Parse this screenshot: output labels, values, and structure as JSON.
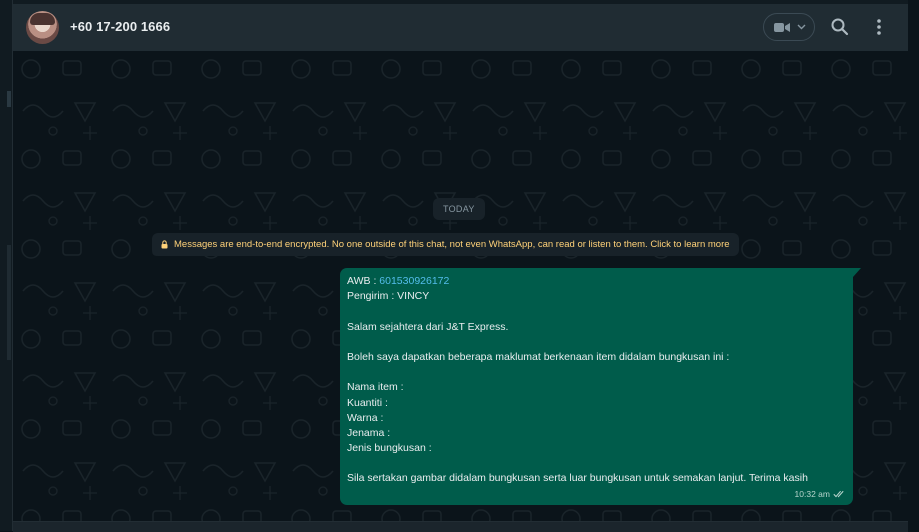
{
  "header": {
    "contact_name": "+60 17-200 1666",
    "video_call_icon": "video-camera-icon",
    "search_icon": "search-icon",
    "menu_icon": "kebab-menu-icon"
  },
  "chat": {
    "date_chip": "TODAY",
    "encryption_notice": "Messages are end-to-end encrypted. No one outside of this chat, not even WhatsApp, can read or listen to them. Click to learn more",
    "message": {
      "awb_label": "AWB : ",
      "awb_number": "601530926172",
      "lines": [
        "Pengirim : VINCY",
        "",
        "Salam sejahtera dari J&T Express.",
        "",
        "Boleh saya dapatkan beberapa maklumat berkenaan item didalam bungkusan ini :",
        "",
        "Nama item :",
        "Kuantiti :",
        "Warna :",
        "Jenama :",
        "Jenis bungkusan :",
        "",
        "Sila sertakan gambar didalam bungkusan serta luar bungkusan untuk semakan lanjut. Terima kasih"
      ],
      "time": "10:32 am",
      "status_icon": "double-check-icon"
    }
  },
  "colors": {
    "header_bg": "#202c33",
    "chat_bg": "#0b141a",
    "outgoing_bubble": "#005c4b",
    "link": "#53bdeb",
    "notice_text": "#ffd279"
  }
}
